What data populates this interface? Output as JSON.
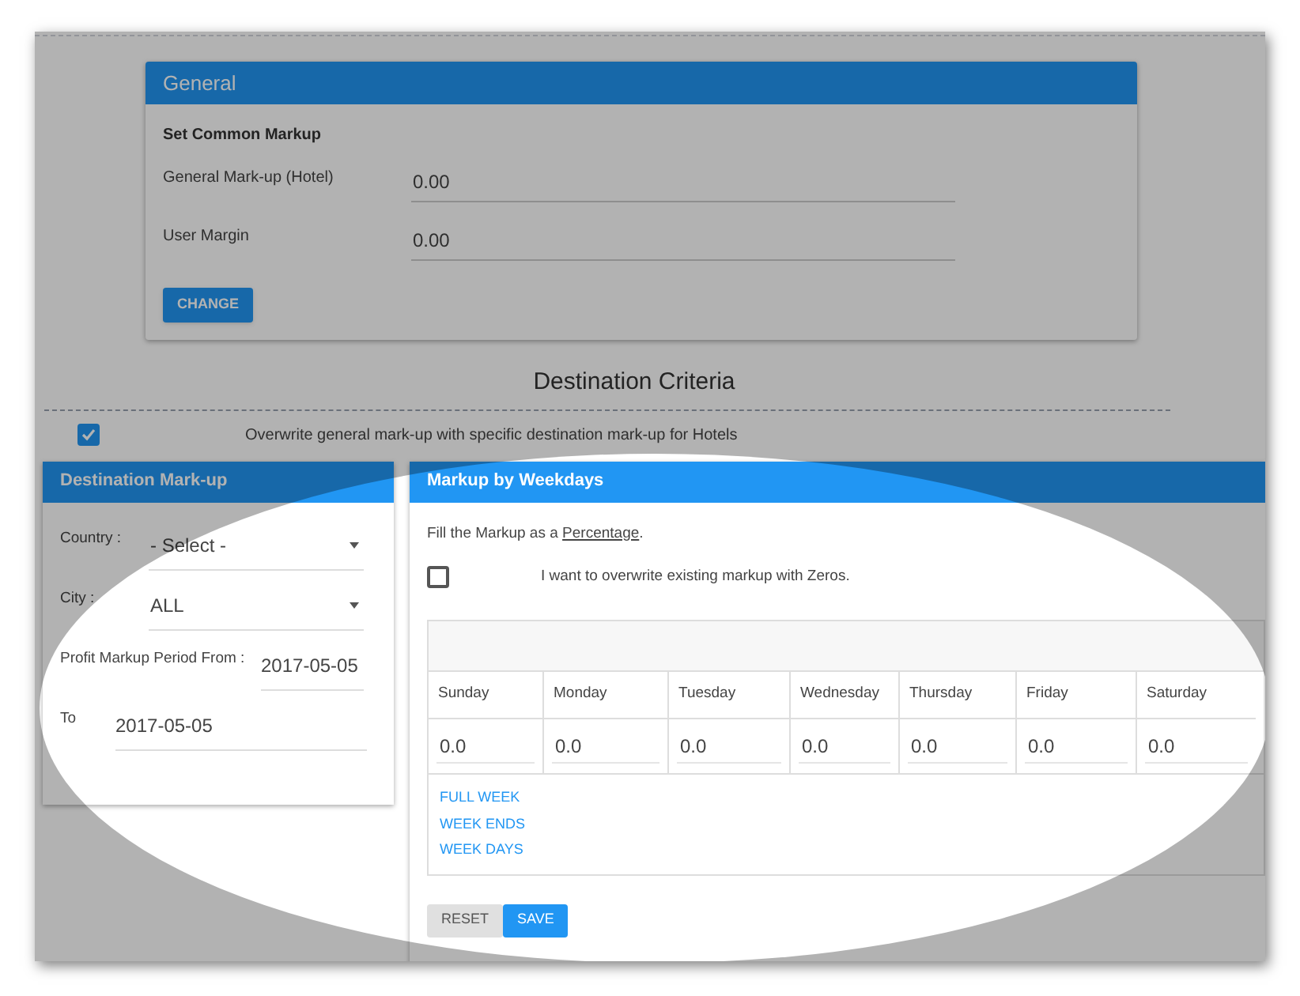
{
  "general": {
    "title": "General",
    "subtitle": "Set Common Markup",
    "fields": [
      {
        "label": "General Mark-up (Hotel)",
        "value": "0.00"
      },
      {
        "label": "User Margin",
        "value": "0.00"
      }
    ],
    "button": "CHANGE"
  },
  "section_title": "Destination Criteria",
  "overwrite_option": {
    "label": "Overwrite general mark-up with specific destination mark-up for Hotels",
    "checked": true
  },
  "destination_markup": {
    "title": "Destination Mark-up",
    "fields": [
      {
        "kind": "select",
        "label": "Country :",
        "value": "- Select -"
      },
      {
        "kind": "select",
        "label": "City :",
        "value": "ALL"
      },
      {
        "kind": "date",
        "label": "Profit Markup Period From :",
        "value": "2017-05-05"
      },
      {
        "kind": "date",
        "label": "To",
        "value": "2017-05-05"
      }
    ]
  },
  "weekdays": {
    "title": "Markup by Weekdays",
    "instruction": "Fill the Markup as a ",
    "instruction_link": "Percentage",
    "instruction_end": ".",
    "zero_option": {
      "label": "I want to overwrite existing markup with Zeros.",
      "checked": false
    },
    "days": [
      {
        "label": "Sunday",
        "value": "0.0"
      },
      {
        "label": "Monday",
        "value": "0.0"
      },
      {
        "label": "Tuesday",
        "value": "0.0"
      },
      {
        "label": "Wednesday",
        "value": "0.0"
      },
      {
        "label": "Thursday",
        "value": "0.0"
      },
      {
        "label": "Friday",
        "value": "0.0"
      },
      {
        "label": "Saturday",
        "value": "0.0"
      }
    ],
    "presets": [
      "FULL WEEK",
      "WEEK ENDS",
      "WEEK DAYS"
    ],
    "buttons": [
      {
        "kind": "reset",
        "label": "RESET"
      },
      {
        "kind": "save",
        "label": "SAVE"
      }
    ]
  }
}
